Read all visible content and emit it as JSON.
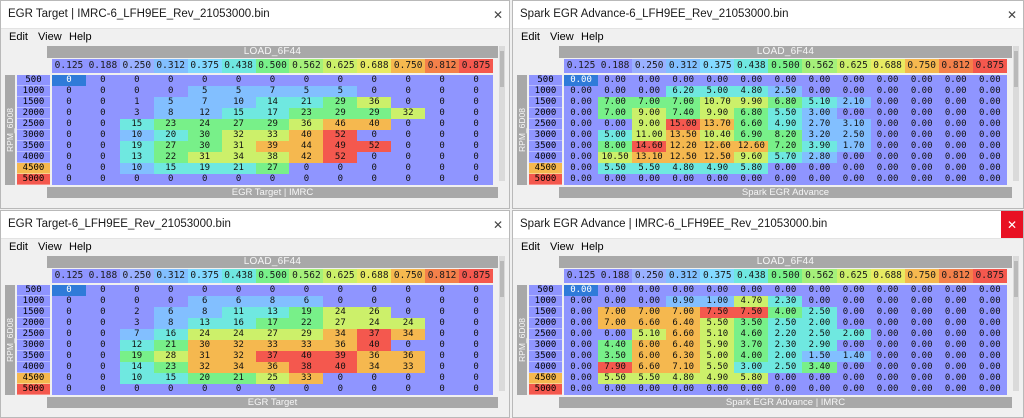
{
  "colors": {
    "heat": [
      "#8f95ff",
      "#82bfff",
      "#6fe8e0",
      "#78f089",
      "#ccf06a",
      "#f5b84f",
      "#f4584e"
    ],
    "ycell": "#8f95ff",
    "ycell_low": "#f5b84f",
    "ycell_lowest": "#f4584e"
  },
  "x_axis": [
    "0.125",
    "0.188",
    "0.250",
    "0.312",
    "0.375",
    "0.438",
    "0.500",
    "0.562",
    "0.625",
    "0.688",
    "0.750",
    "0.812",
    "0.875"
  ],
  "y_axis": [
    "500",
    "1000",
    "1500",
    "2000",
    "2500",
    "3000",
    "3500",
    "4000",
    "4500",
    "5000"
  ],
  "windows": [
    {
      "id": "w1",
      "title": "EGR Target | IMRC-6_LFH9EE_Rev_21053000.bin",
      "close_active": false,
      "menu": [
        "Edit",
        "View",
        "Help"
      ],
      "header": "LOAD_6F44",
      "side_label": "RPM_6D08",
      "footer": "EGR Target | IMRC",
      "decimals": 0,
      "max": 52,
      "table": [
        [
          0,
          0,
          0,
          0,
          0,
          0,
          0,
          0,
          0,
          0,
          0,
          0,
          0
        ],
        [
          0,
          0,
          0,
          0,
          5,
          5,
          7,
          5,
          5,
          0,
          0,
          0,
          0
        ],
        [
          0,
          0,
          1,
          5,
          7,
          10,
          14,
          21,
          29,
          36,
          0,
          0,
          0
        ],
        [
          0,
          0,
          3,
          8,
          12,
          15,
          17,
          23,
          29,
          29,
          32,
          0,
          0
        ],
        [
          0,
          0,
          15,
          23,
          24,
          27,
          29,
          36,
          46,
          40,
          0,
          0,
          0
        ],
        [
          0,
          0,
          10,
          20,
          30,
          32,
          33,
          40,
          52,
          0,
          0,
          0,
          0
        ],
        [
          0,
          0,
          19,
          27,
          30,
          31,
          39,
          44,
          49,
          52,
          0,
          0,
          0
        ],
        [
          0,
          0,
          13,
          22,
          31,
          34,
          38,
          42,
          52,
          0,
          0,
          0,
          0
        ],
        [
          0,
          0,
          10,
          15,
          19,
          21,
          27,
          0,
          0,
          0,
          0,
          0,
          0
        ],
        [
          0,
          0,
          0,
          0,
          0,
          0,
          0,
          0,
          0,
          0,
          0,
          0,
          0
        ]
      ]
    },
    {
      "id": "w2",
      "title": "Spark EGR Advance-6_LFH9EE_Rev_21053000.bin",
      "close_active": false,
      "menu": [
        "Edit",
        "View",
        "Help"
      ],
      "header": "LOAD_6F44",
      "side_label": "RPM_6D08",
      "footer": "Spark EGR Advance",
      "decimals": 2,
      "max": 15,
      "table": [
        [
          0,
          0,
          0,
          0,
          0,
          0,
          0,
          0,
          0,
          0,
          0,
          0,
          0
        ],
        [
          0,
          0,
          0,
          6.2,
          5,
          4.8,
          2.5,
          0,
          0,
          0,
          0,
          0,
          0
        ],
        [
          0,
          7,
          7,
          7,
          10.7,
          9.9,
          6.8,
          5.1,
          2.1,
          0,
          0,
          0,
          0
        ],
        [
          0,
          7,
          9,
          7.4,
          9.9,
          6.8,
          5.5,
          3,
          0,
          0,
          0,
          0,
          0
        ],
        [
          0,
          0,
          9,
          15,
          13.7,
          6.6,
          4.9,
          2.7,
          3.1,
          0,
          0,
          0,
          0
        ],
        [
          0,
          5,
          11,
          13.5,
          10.4,
          6.9,
          8.2,
          3.2,
          2.5,
          0,
          0,
          0,
          0
        ],
        [
          0,
          8,
          14.6,
          12.2,
          12.6,
          12.6,
          7.2,
          3.9,
          1.7,
          0,
          0,
          0,
          0
        ],
        [
          0,
          10.5,
          13.1,
          12.5,
          12.5,
          9.6,
          5.7,
          2.8,
          0,
          0,
          0,
          0,
          0
        ],
        [
          0,
          5.5,
          5.5,
          4.8,
          4.9,
          5.8,
          0,
          0,
          0,
          0,
          0,
          0,
          0
        ],
        [
          0,
          0,
          0,
          0,
          0,
          0,
          0,
          0,
          0,
          0,
          0,
          0,
          0
        ]
      ]
    },
    {
      "id": "w3",
      "title": "EGR Target-6_LFH9EE_Rev_21053000.bin",
      "close_active": false,
      "menu": [
        "Edit",
        "View",
        "Help"
      ],
      "header": "LOAD_6F44",
      "side_label": "RPM_6D08",
      "footer": "EGR Target",
      "decimals": 0,
      "max": 40,
      "table": [
        [
          0,
          0,
          0,
          0,
          0,
          0,
          0,
          0,
          0,
          0,
          0,
          0,
          0
        ],
        [
          0,
          0,
          0,
          0,
          6,
          6,
          8,
          6,
          0,
          0,
          0,
          0,
          0
        ],
        [
          0,
          0,
          2,
          6,
          8,
          11,
          13,
          19,
          24,
          26,
          0,
          0,
          0
        ],
        [
          0,
          0,
          3,
          8,
          13,
          16,
          17,
          22,
          27,
          24,
          24,
          0,
          0
        ],
        [
          0,
          0,
          7,
          16,
          24,
          24,
          27,
          29,
          34,
          37,
          34,
          0,
          0
        ],
        [
          0,
          0,
          12,
          21,
          30,
          32,
          33,
          33,
          36,
          40,
          0,
          0,
          0
        ],
        [
          0,
          0,
          19,
          28,
          31,
          32,
          37,
          40,
          39,
          36,
          36,
          0,
          0
        ],
        [
          0,
          0,
          14,
          23,
          32,
          34,
          36,
          38,
          40,
          34,
          33,
          0,
          0
        ],
        [
          0,
          0,
          10,
          15,
          20,
          21,
          25,
          33,
          0,
          0,
          0,
          0,
          0
        ],
        [
          0,
          0,
          0,
          0,
          0,
          0,
          0,
          0,
          0,
          0,
          0,
          0,
          0
        ]
      ]
    },
    {
      "id": "w4",
      "title": "Spark EGR Advance | IMRC-6_LFH9EE_Rev_21053000.bin",
      "close_active": true,
      "menu": [
        "Edit",
        "View",
        "Help"
      ],
      "header": "LOAD_6F44",
      "side_label": "RPM_6D08",
      "footer": "Spark EGR Advance | IMRC",
      "decimals": 2,
      "max": 7.9,
      "table": [
        [
          0,
          0,
          0,
          0,
          0,
          0,
          0,
          0,
          0,
          0,
          0,
          0,
          0
        ],
        [
          0,
          0,
          0,
          0.9,
          1,
          4.7,
          2.3,
          0,
          0,
          0,
          0,
          0,
          0
        ],
        [
          0,
          7,
          7,
          7,
          7.5,
          7.5,
          4,
          2.5,
          0,
          0,
          0,
          0,
          0
        ],
        [
          0,
          7,
          6.6,
          6.4,
          5.5,
          3.5,
          2.5,
          2,
          0,
          0,
          0,
          0,
          0
        ],
        [
          0,
          0,
          5.1,
          6.6,
          5.1,
          4.6,
          2.2,
          2.5,
          2,
          0,
          0,
          0,
          0
        ],
        [
          0,
          4.4,
          6,
          6.4,
          5.9,
          3.7,
          2.3,
          2.9,
          0,
          0,
          0,
          0,
          0
        ],
        [
          0,
          3.5,
          6,
          6.3,
          5,
          4,
          2,
          1.5,
          1.4,
          0,
          0,
          0,
          0
        ],
        [
          0,
          7.9,
          6.6,
          7.1,
          5.5,
          3,
          2.5,
          3.4,
          0,
          0,
          0,
          0,
          0
        ],
        [
          0,
          5.5,
          5.5,
          4.8,
          4.9,
          5.8,
          0,
          0,
          0,
          0,
          0,
          0,
          0
        ],
        [
          0,
          0,
          0,
          0,
          0,
          0,
          0,
          0,
          0,
          0,
          0,
          0,
          0
        ]
      ]
    }
  ]
}
